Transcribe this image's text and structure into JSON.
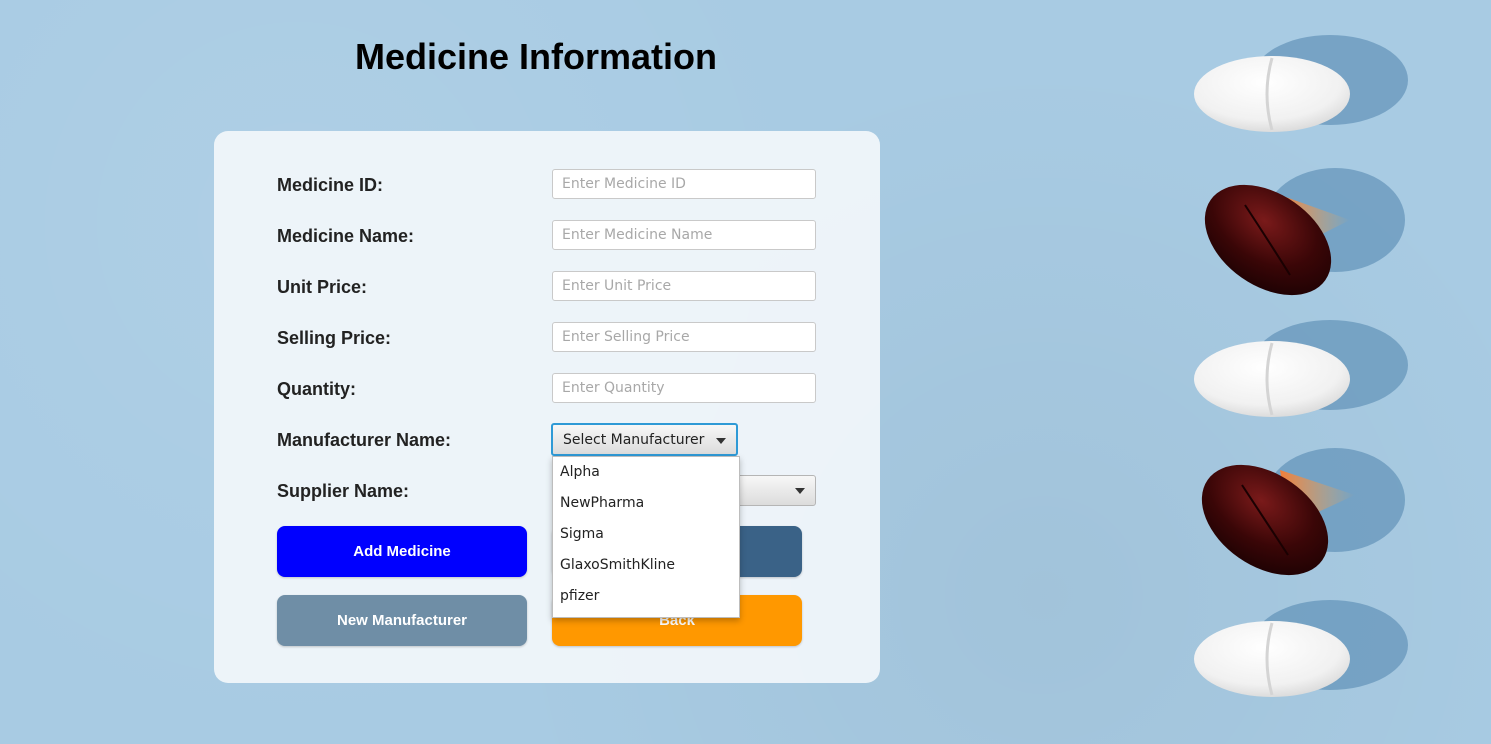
{
  "page": {
    "title": "Medicine Information"
  },
  "form": {
    "fields": [
      {
        "label": "Medicine ID:",
        "placeholder": "Enter Medicine ID"
      },
      {
        "label": "Medicine Name:",
        "placeholder": "Enter Medicine Name"
      },
      {
        "label": "Unit Price:",
        "placeholder": "Enter Unit Price"
      },
      {
        "label": "Selling Price:",
        "placeholder": "Enter Selling Price"
      },
      {
        "label": "Quantity:",
        "placeholder": "Enter Quantity"
      }
    ],
    "manufacturer": {
      "label": "Manufacturer Name:",
      "selected": "Select Manufacturer",
      "options": [
        "Alpha",
        "NewPharma",
        "Sigma",
        "GlaxoSmithKline",
        "pfizer"
      ]
    },
    "supplier": {
      "label": "Supplier Name:",
      "selected": ""
    }
  },
  "buttons": {
    "add": "Add Medicine",
    "second": "",
    "new_manufacturer": "New Manufacturer",
    "back": "Back"
  },
  "colors": {
    "background": "#a8cbe3",
    "add_button": "#0000ff",
    "second_button": "#3a6287",
    "new_manufacturer_button": "#6f8ea6",
    "back_button": "#ff9800",
    "focus": "#2f9ad6"
  },
  "decor": {
    "image": "pills-and-capsules"
  }
}
